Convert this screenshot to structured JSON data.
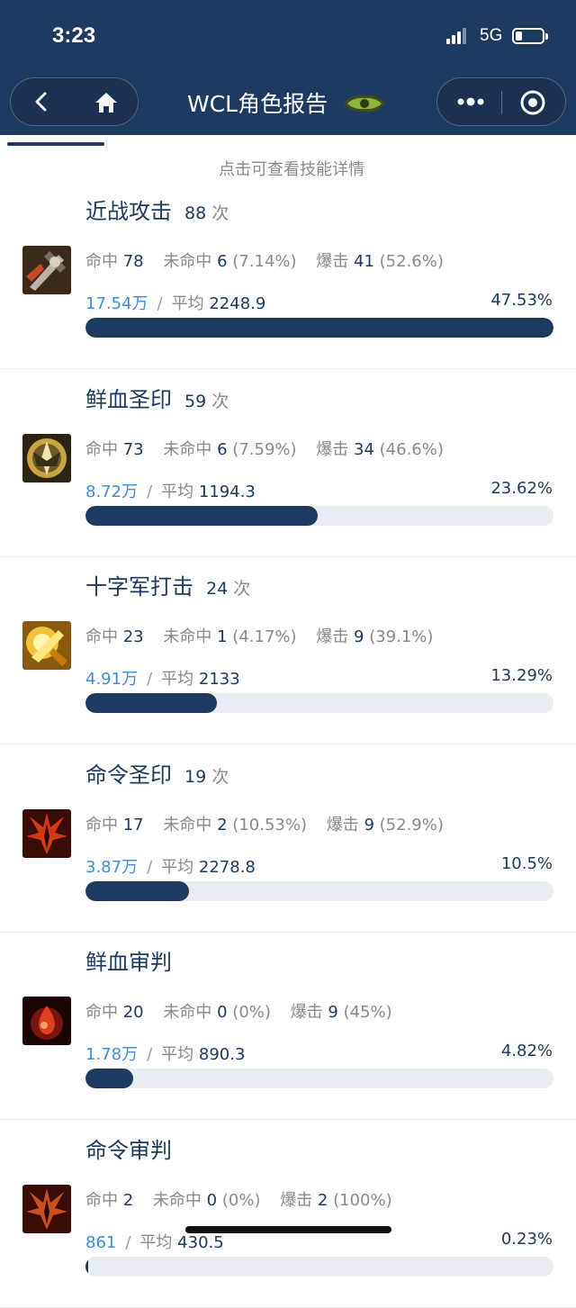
{
  "status": {
    "time": "3:23",
    "network": "5G"
  },
  "nav": {
    "title": "WCL角色报告"
  },
  "hint": "点击可查看技能详情",
  "count_unit": "次",
  "labels": {
    "hit": "命中",
    "miss": "未命中",
    "crit": "爆击",
    "avg": "平均",
    "slash": "/"
  },
  "skills": [
    {
      "name": "近战攻击",
      "count": "88",
      "hit": "78",
      "miss": "6",
      "miss_pct": "(7.14%)",
      "crit": "41",
      "crit_pct": "(52.6%)",
      "amount": "17.54万",
      "avg": "2248.9",
      "percent": "47.53%",
      "fill": 1.0,
      "icon": "melee-attack-icon"
    },
    {
      "name": "鲜血圣印",
      "count": "59",
      "hit": "73",
      "miss": "6",
      "miss_pct": "(7.59%)",
      "crit": "34",
      "crit_pct": "(46.6%)",
      "amount": "8.72万",
      "avg": "1194.3",
      "percent": "23.62%",
      "fill": 0.497,
      "icon": "seal-of-blood-icon"
    },
    {
      "name": "十字军打击",
      "count": "24",
      "hit": "23",
      "miss": "1",
      "miss_pct": "(4.17%)",
      "crit": "9",
      "crit_pct": "(39.1%)",
      "amount": "4.91万",
      "avg": "2133",
      "percent": "13.29%",
      "fill": 0.28,
      "icon": "crusader-strike-icon"
    },
    {
      "name": "命令圣印",
      "count": "19",
      "hit": "17",
      "miss": "2",
      "miss_pct": "(10.53%)",
      "crit": "9",
      "crit_pct": "(52.9%)",
      "amount": "3.87万",
      "avg": "2278.8",
      "percent": "10.5%",
      "fill": 0.221,
      "icon": "seal-of-command-icon"
    },
    {
      "name": "鲜血审判",
      "count": "",
      "hit": "20",
      "miss": "0",
      "miss_pct": "(0%)",
      "crit": "9",
      "crit_pct": "(45%)",
      "amount": "1.78万",
      "avg": "890.3",
      "percent": "4.82%",
      "fill": 0.101,
      "icon": "judgement-of-blood-icon"
    },
    {
      "name": "命令审判",
      "count": "",
      "hit": "2",
      "miss": "0",
      "miss_pct": "(0%)",
      "crit": "2",
      "crit_pct": "(100%)",
      "amount": "861",
      "avg": "430.5",
      "percent": "0.23%",
      "fill": 0.005,
      "icon": "judgement-of-command-icon"
    }
  ],
  "colors": {
    "header": "#1f3a60",
    "accent": "#3d8ce0",
    "bar_track": "#e9ecf3"
  }
}
